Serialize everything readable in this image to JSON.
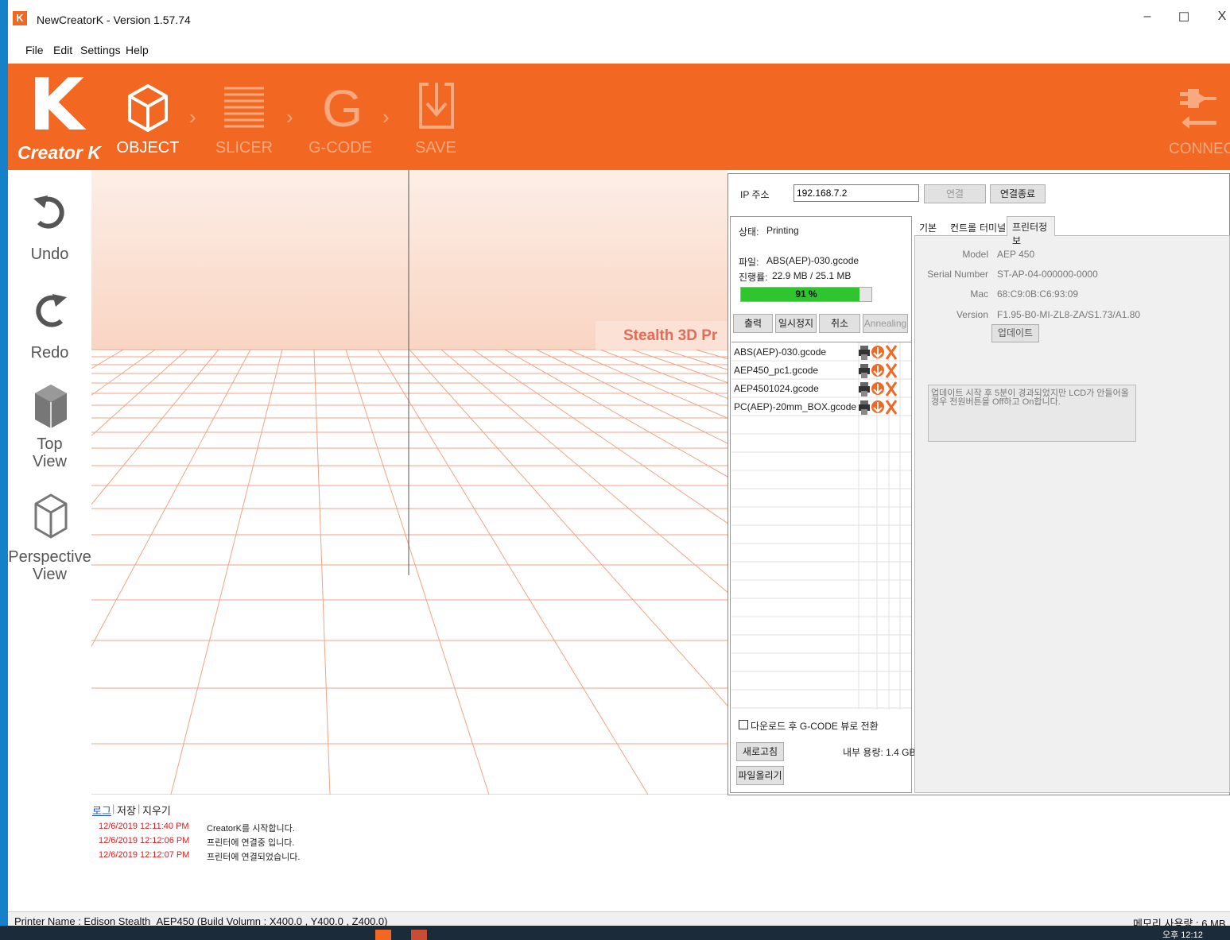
{
  "window": {
    "app_icon": "K",
    "title": "NewCreatorK - Version 1.57.74",
    "minimize": "–",
    "maximize": "☐",
    "close": "X"
  },
  "menu": [
    "File",
    "Edit",
    "Settings",
    "Help"
  ],
  "toolbar": {
    "logo_letter": "K",
    "logo_text": "Creator K",
    "steps": [
      {
        "label": "OBJECT",
        "active": true
      },
      {
        "label": "SLICER",
        "active": false
      },
      {
        "label": "G-CODE",
        "active": false
      },
      {
        "label": "SAVE",
        "active": false
      }
    ],
    "connect_label": "CONNECT",
    "accent_color": "#f26722"
  },
  "view_tools": {
    "undo": "Undo",
    "redo": "Redo",
    "top_view": "Top\nView",
    "perspective_view": "Perspective\nView"
  },
  "viewport": {
    "banner_text": "Stealth 3D Pr"
  },
  "printer": {
    "ip_label": "IP 주소",
    "ip_value": "192.168.7.2",
    "connect_btn": "연결",
    "disconnect_btn": "연결종료",
    "status_label": "상태:",
    "status_value": "Printing",
    "file_label": "파일:",
    "file_value": "ABS(AEP)-030.gcode",
    "progress_label": "진행률:",
    "progress_value": "22.9 MB / 25.1 MB",
    "progress_percent": 91,
    "progress_text": "91 %",
    "actions": [
      "출력",
      "일시정지",
      "취소",
      "Annealing"
    ],
    "files": [
      "ABS(AEP)-030.gcode",
      "AEP450_pc1.gcode",
      "AEP4501024.gcode",
      "PC(AEP)-20mm_BOX.gcode"
    ],
    "switch_checkbox": "다운로드 후 G-CODE 뷰로 전환",
    "refresh_btn": "새로고침",
    "storage": "내부 용량: 1.4 GB",
    "upload_btn": "파일올리기",
    "tabs": [
      "기본",
      "컨트롤",
      "터미널",
      "프린터정보"
    ],
    "info": {
      "model_label": "Model",
      "model_value": "AEP 450",
      "serial_label": "Serial Number",
      "serial_value": "ST-AP-04-000000-0000",
      "mac_label": "Mac",
      "mac_value": "68:C9:0B:C6:93:09",
      "version_label": "Version",
      "version_value": "F1.95-B0-MI-ZL8-ZA/S1.73/A1.80",
      "update_btn": "업데이트",
      "notice": "업데이트 시작 후 5분이 경과되었지만 LCD가 안들어올 경우 전원버튼을 Off하고 On합니다."
    }
  },
  "log": {
    "tabs": [
      "로그",
      "저장",
      "지우기"
    ],
    "entries": [
      {
        "time": "12/6/2019 12:11:40 PM",
        "message": "CreatorK를 시작합니다."
      },
      {
        "time": "12/6/2019 12:12:06 PM",
        "message": "프린터에 연결중 입니다."
      },
      {
        "time": "12/6/2019 12:12:07 PM",
        "message": "프린터에 연결되었습니다."
      }
    ]
  },
  "status": {
    "printer_name": "Printer Name :   Edison Stealth_AEP450 (Build Volumn : X400.0 , Y400.0 , Z400.0)",
    "memory": "메모리 사용량 : 6 MB",
    "clock": "오후 12:12"
  }
}
